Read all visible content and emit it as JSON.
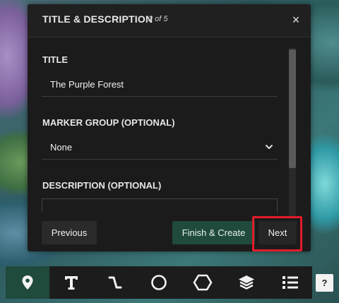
{
  "modal": {
    "title": "TITLE & DESCRIPTION",
    "step": "2 of 5",
    "close_label": "×"
  },
  "fields": {
    "title_label": "TITLE",
    "title_value": "The Purple Forest",
    "group_label": "MARKER GROUP (OPTIONAL)",
    "group_value": "None",
    "description_label": "DESCRIPTION (OPTIONAL)",
    "description_value": ""
  },
  "footer": {
    "previous_label": "Previous",
    "finish_label": "Finish & Create",
    "next_label": "Next"
  },
  "toolbar": {
    "tools": [
      {
        "name": "marker",
        "icon": "map-pin-icon",
        "active": true
      },
      {
        "name": "text",
        "icon": "text-icon",
        "active": false
      },
      {
        "name": "line",
        "icon": "path-icon",
        "active": false
      },
      {
        "name": "circle",
        "icon": "circle-icon",
        "active": false
      },
      {
        "name": "polygon",
        "icon": "hexagon-icon",
        "active": false
      },
      {
        "name": "layers",
        "icon": "layers-icon",
        "active": false
      },
      {
        "name": "list",
        "icon": "list-icon",
        "active": false
      }
    ],
    "help_label": "?"
  },
  "colors": {
    "accent": "#1f4a3c",
    "highlight": "#e21b2b",
    "panel": "#1b1b1b"
  }
}
